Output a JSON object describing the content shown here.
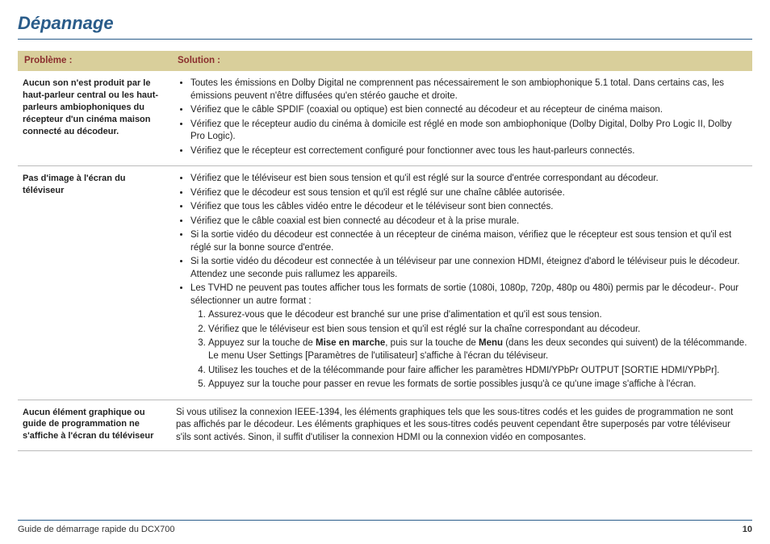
{
  "title": "Dépannage",
  "headers": {
    "problem": "Problème :",
    "solution": "Solution :"
  },
  "rows": [
    {
      "problem": "Aucun son n'est produit par le haut-parleur central ou les haut-parleurs ambiophoniques du récepteur d'un cinéma maison connecté au décodeur.",
      "bullets": [
        "Toutes les émissions en Dolby Digital ne comprennent pas nécessairement le son ambiophonique 5.1 total. Dans certains cas, les émissions peuvent n'être diffusées qu'en stéréo gauche et droite.",
        "Vérifiez que le câble SPDIF (coaxial ou optique) est bien connecté au décodeur et au récepteur de cinéma maison.",
        "Vérifiez que le récepteur audio du cinéma à domicile est réglé en mode son ambiophonique (Dolby Digital, Dolby Pro Logic II, Dolby Pro Logic).",
        "Vérifiez que le récepteur est correctement configuré pour fonctionner avec tous les haut-parleurs connectés."
      ]
    },
    {
      "problem": "Pas d'image à l'écran du téléviseur",
      "bullets": [
        "Vérifiez que le téléviseur est bien sous tension et qu'il est réglé sur la source d'entrée correspondant au décodeur.",
        "Vérifiez que le décodeur est sous tension et qu'il est réglé sur une chaîne câblée autorisée.",
        "Vérifiez que tous les câbles vidéo entre le décodeur et le téléviseur sont bien connectés.",
        "Vérifiez que le câble coaxial est bien connecté au décodeur et à la prise murale.",
        "Si la sortie vidéo du décodeur est connectée à un récepteur de cinéma maison, vérifiez que le récepteur est sous tension et qu'il est réglé sur la bonne source d'entrée.",
        "Si la sortie vidéo du décodeur est connectée à un téléviseur par une connexion HDMI, éteignez d'abord le téléviseur puis le décodeur. Attendez une seconde puis rallumez les appareils."
      ],
      "last_bullet_intro": "Les TVHD ne peuvent pas toutes afficher tous les formats de sortie (1080i, 1080p, 720p, 480p ou 480i) permis par le décodeur-. Pour sélectionner un autre format :",
      "sublist": [
        "Assurez-vous que le décodeur est branché sur une prise d'alimentation et qu'il est sous tension.",
        "Vérifiez que le téléviseur est bien sous tension et qu'il est réglé sur la chaîne correspondant au décodeur.",
        {
          "pre": "Appuyez sur la touche de ",
          "b1": "Mise en marche",
          "mid": ", puis sur la touche de ",
          "b2": "Menu",
          "post": " (dans les deux secondes qui suivent) de la télécommande. Le menu User Settings [Paramètres de l'utilisateur] s'affiche à l'écran du téléviseur."
        },
        "Utilisez les touches  et  de la télécommande pour faire afficher les paramètres HDMI/YPbPr OUTPUT [SORTIE HDMI/YPbPr].",
        "Appuyez sur la touche  pour passer en revue les formats de sortie possibles jusqu'à ce qu'une image s'affiche à l'écran."
      ]
    },
    {
      "problem": "Aucun élément graphique ou guide de programmation ne s'affiche à l'écran du téléviseur",
      "paragraph": "Si vous utilisez la connexion IEEE-1394, les éléments graphiques tels que les sous-titres codés et les guides de programmation ne sont pas affichés par le décodeur. Les éléments graphiques et les sous-titres codés peuvent cependant être superposés par votre téléviseur s'ils sont activés. Sinon, il suffit d'utiliser la connexion HDMI ou la connexion vidéo en composantes."
    }
  ],
  "footer": {
    "text": "Guide de démarrage rapide du DCX700",
    "page": "10"
  }
}
